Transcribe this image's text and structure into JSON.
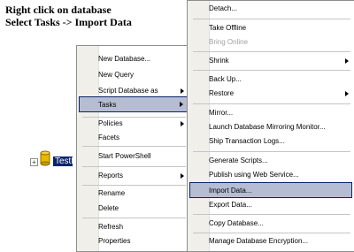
{
  "caption": {
    "line1": "Right click on database",
    "line2": "Select Tasks -> Import Data"
  },
  "tree": {
    "node_label": "TestD"
  },
  "context_menu": {
    "items": [
      {
        "label": "New Database..."
      },
      {
        "label": "New Query"
      },
      {
        "label": "Script Database as"
      },
      {
        "label": "Tasks"
      },
      {
        "label": "Policies"
      },
      {
        "label": "Facets"
      },
      {
        "label": "Start PowerShell"
      },
      {
        "label": "Reports"
      },
      {
        "label": "Rename"
      },
      {
        "label": "Delete"
      },
      {
        "label": "Refresh"
      },
      {
        "label": "Properties"
      }
    ]
  },
  "tasks_submenu": {
    "items": [
      {
        "label": "Detach..."
      },
      {
        "label": "Take Offline"
      },
      {
        "label": "Bring Online"
      },
      {
        "label": "Shrink"
      },
      {
        "label": "Back Up..."
      },
      {
        "label": "Restore"
      },
      {
        "label": "Mirror..."
      },
      {
        "label": "Launch Database Mirroring Monitor..."
      },
      {
        "label": "Ship Transaction Logs..."
      },
      {
        "label": "Generate Scripts..."
      },
      {
        "label": "Publish using Web Service..."
      },
      {
        "label": "Import Data..."
      },
      {
        "label": "Export Data..."
      },
      {
        "label": "Copy Database..."
      },
      {
        "label": "Manage Database Encryption..."
      }
    ]
  },
  "colors": {
    "highlight": "#b6bdd2",
    "selection": "#0a246a",
    "disabled_text": "#a0a0a0"
  }
}
